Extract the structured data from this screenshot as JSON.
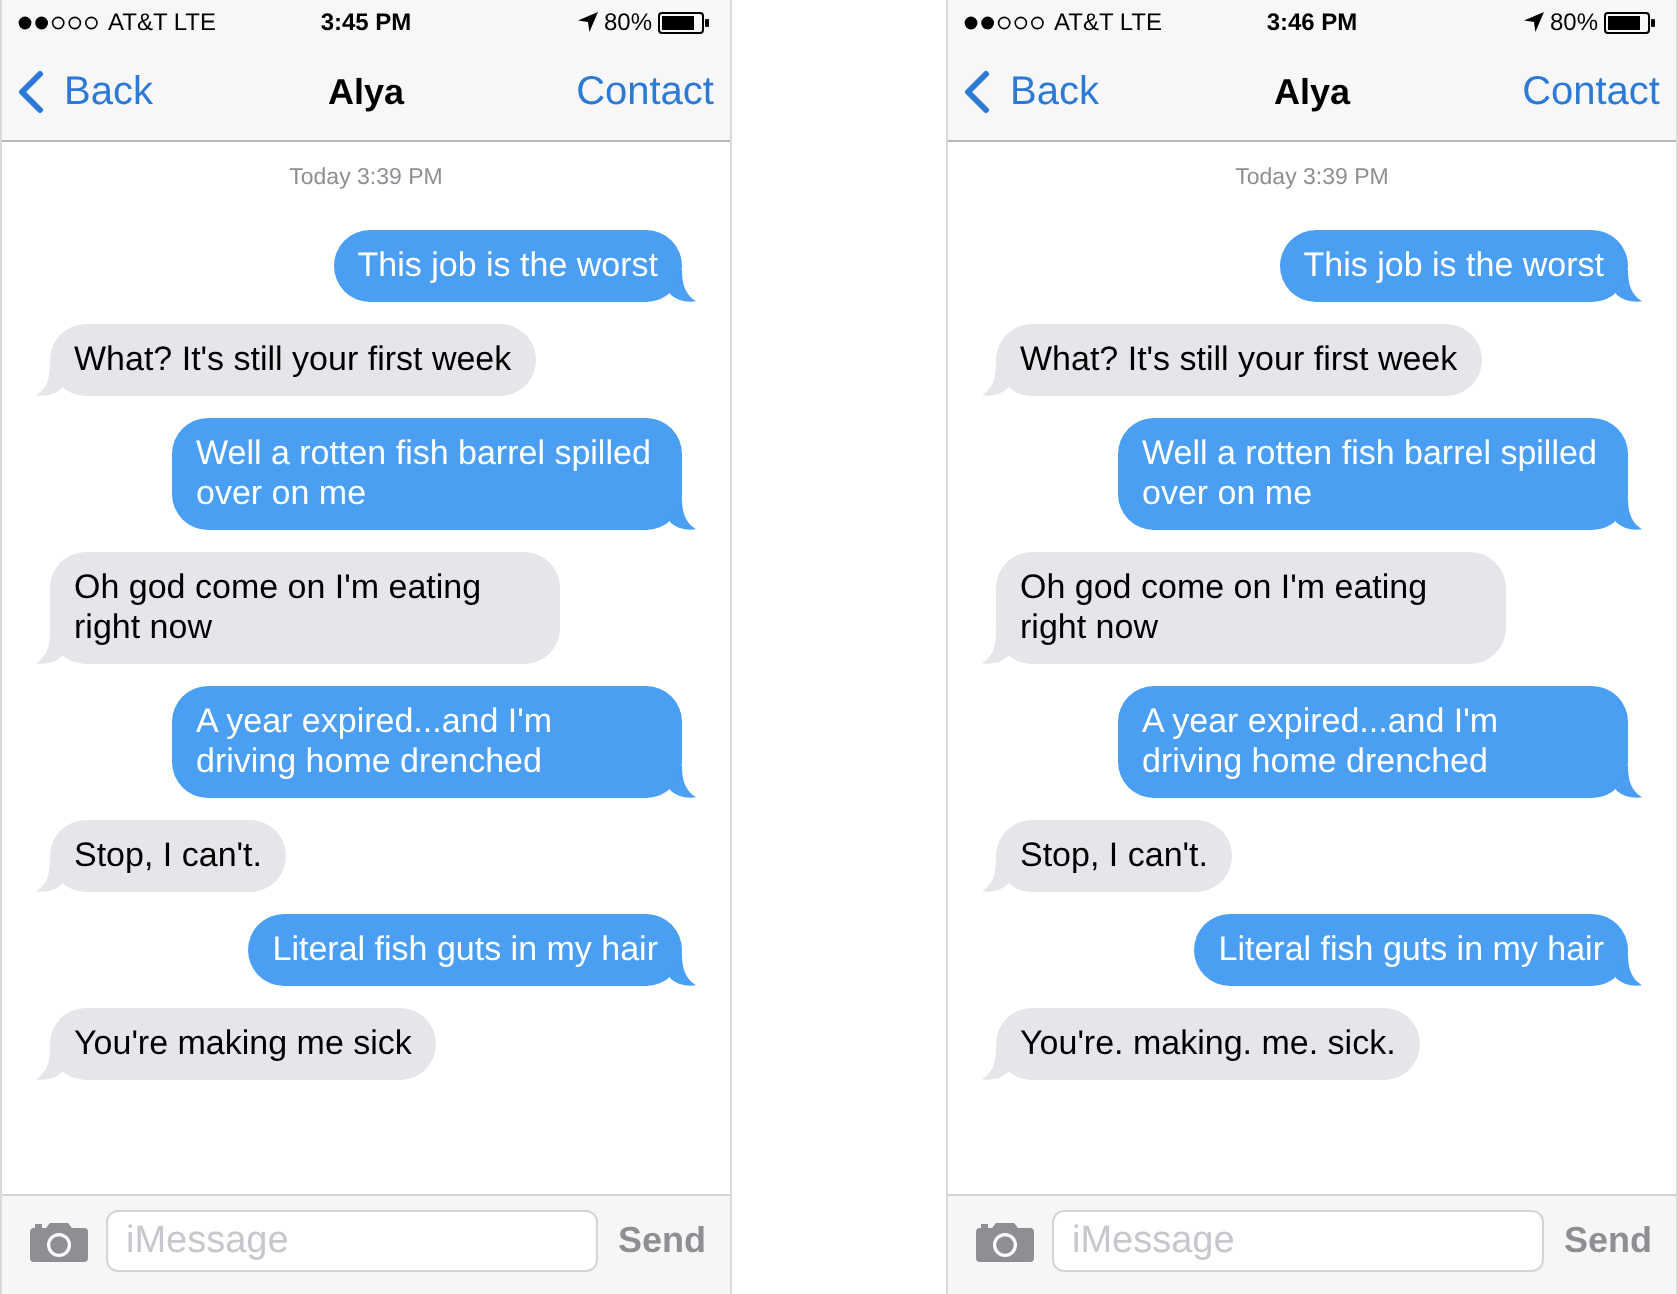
{
  "phones": [
    {
      "status_bar": {
        "carrier": "AT&T LTE",
        "time": "3:45 PM",
        "battery": "80%"
      },
      "nav_bar": {
        "back": "Back",
        "title": "Alya",
        "action": "Contact"
      },
      "timestamp": "Today 3:39 PM",
      "messages": [
        {
          "kind": "sent",
          "text": "This job is the worst"
        },
        {
          "kind": "received",
          "text": "What? It's still your first week"
        },
        {
          "kind": "sent",
          "text": "Well a rotten fish barrel spilled over on me"
        },
        {
          "kind": "received",
          "text": "Oh god come on I'm eating right now"
        },
        {
          "kind": "sent",
          "text": "A year expired...and I'm driving home drenched"
        },
        {
          "kind": "received",
          "text": "Stop, I can't."
        },
        {
          "kind": "sent",
          "text": "Literal fish guts in my hair"
        },
        {
          "kind": "received",
          "text": "You're making me sick"
        }
      ],
      "composer": {
        "placeholder": "iMessage",
        "send": "Send"
      }
    },
    {
      "status_bar": {
        "carrier": "AT&T LTE",
        "time": "3:46 PM",
        "battery": "80%"
      },
      "nav_bar": {
        "back": "Back",
        "title": "Alya",
        "action": "Contact"
      },
      "timestamp": "Today 3:39 PM",
      "messages": [
        {
          "kind": "sent",
          "text": "This job is the worst"
        },
        {
          "kind": "received",
          "text": "What? It's still your first week"
        },
        {
          "kind": "sent",
          "text": "Well a rotten fish barrel spilled over on me"
        },
        {
          "kind": "received",
          "text": "Oh god come on I'm eating right now"
        },
        {
          "kind": "sent",
          "text": "A year expired...and I'm driving home drenched"
        },
        {
          "kind": "received",
          "text": "Stop, I can't."
        },
        {
          "kind": "sent",
          "text": "Literal fish guts in my hair"
        },
        {
          "kind": "received",
          "text": "You're. making. me. sick."
        }
      ],
      "composer": {
        "placeholder": "iMessage",
        "send": "Send"
      }
    }
  ]
}
